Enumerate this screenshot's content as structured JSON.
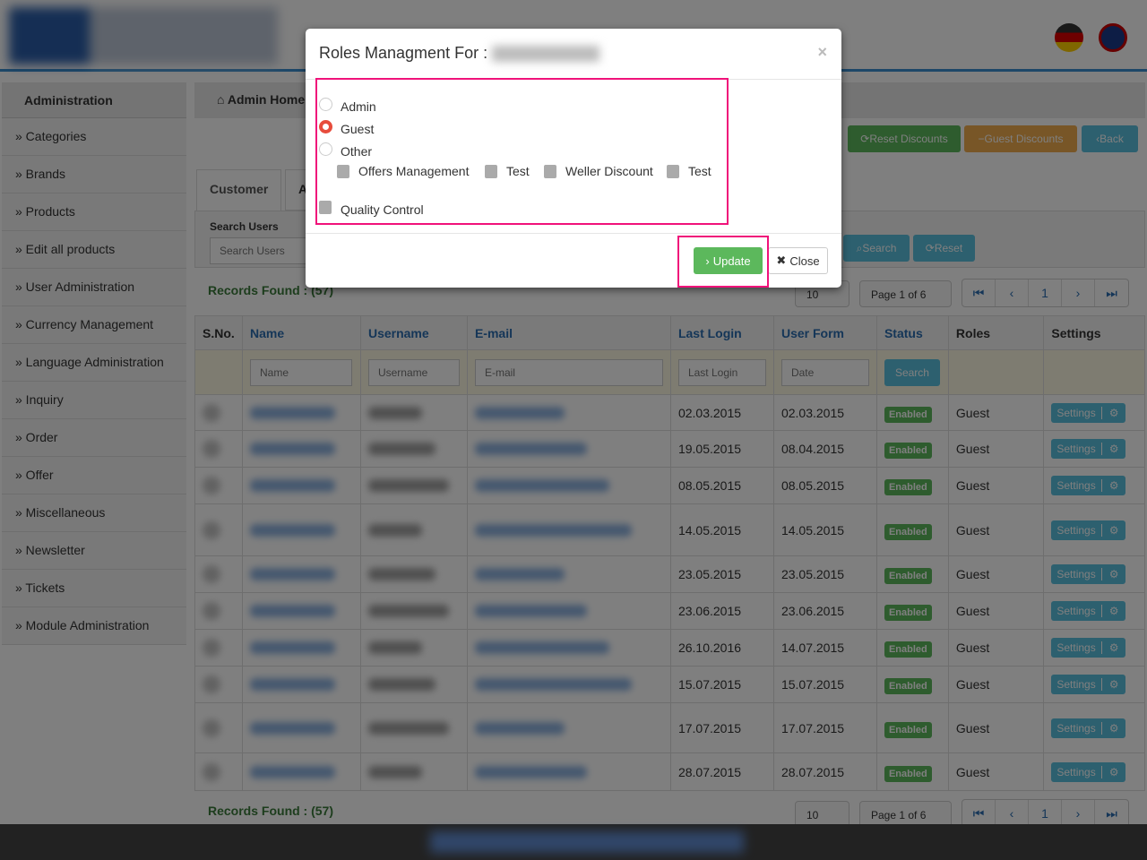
{
  "sidebar": {
    "title": "Administration",
    "items": [
      "» Categories",
      "» Brands",
      "» Products",
      "» Edit all products",
      "» User Administration",
      "» Currency Management",
      "» Language Administration",
      "» Inquiry",
      "» Order",
      "» Offer",
      "» Miscellaneous",
      "» Newsletter",
      "» Tickets",
      "» Module Administration"
    ]
  },
  "breadcrumb": "Admin Home",
  "actions": {
    "reset_discounts": "Reset Discounts",
    "guest_discounts": "Guest Discounts",
    "back": "Back"
  },
  "tabs": {
    "customer": "Customer",
    "second": "A"
  },
  "search": {
    "label": "Search Users",
    "placeholder": "Search Users",
    "search": "Search",
    "reset": "Reset"
  },
  "records": "Records Found : (57)",
  "pager": {
    "per_page": "10",
    "page": "Page 1 of 6",
    "current": "1"
  },
  "table": {
    "headers": [
      "S.No.",
      "Name",
      "Username",
      "E-mail",
      "Last Login",
      "User Form",
      "Status",
      "Roles",
      "Settings"
    ],
    "filters": {
      "name": "Name",
      "username": "Username",
      "email": "E-mail",
      "last_login": "Last Login",
      "date": "Date",
      "search": "Search"
    },
    "rows": [
      {
        "last": "02.03.2015",
        "form": "02.03.2015",
        "status": "Enabled",
        "role": "Guest",
        "settings": "Settings"
      },
      {
        "last": "19.05.2015",
        "form": "08.04.2015",
        "status": "Enabled",
        "role": "Guest",
        "settings": "Settings"
      },
      {
        "last": "08.05.2015",
        "form": "08.05.2015",
        "status": "Enabled",
        "role": "Guest",
        "settings": "Settings"
      },
      {
        "last": "14.05.2015",
        "form": "14.05.2015",
        "status": "Enabled",
        "role": "Guest",
        "settings": "Settings"
      },
      {
        "last": "23.05.2015",
        "form": "23.05.2015",
        "status": "Enabled",
        "role": "Guest",
        "settings": "Settings"
      },
      {
        "last": "23.06.2015",
        "form": "23.06.2015",
        "status": "Enabled",
        "role": "Guest",
        "settings": "Settings"
      },
      {
        "last": "26.10.2016",
        "form": "14.07.2015",
        "status": "Enabled",
        "role": "Guest",
        "settings": "Settings"
      },
      {
        "last": "15.07.2015",
        "form": "15.07.2015",
        "status": "Enabled",
        "role": "Guest",
        "settings": "Settings"
      },
      {
        "last": "17.07.2015",
        "form": "17.07.2015",
        "status": "Enabled",
        "role": "Guest",
        "settings": "Settings"
      },
      {
        "last": "28.07.2015",
        "form": "28.07.2015",
        "status": "Enabled",
        "role": "Guest",
        "settings": "Settings"
      }
    ]
  },
  "modal": {
    "title": "Roles Managment For :",
    "roles": [
      "Admin",
      "Guest",
      "Other"
    ],
    "selected_role": "Guest",
    "permissions": [
      "Offers Management",
      "Test",
      "Weller Discount",
      "Test",
      "Quality Control"
    ],
    "update": "Update",
    "close": "Close",
    "close_x": "×"
  },
  "colors": {
    "accent": "#f0127a",
    "success": "#5cb85c",
    "info": "#5bc0de",
    "warning": "#f0ad4e"
  }
}
